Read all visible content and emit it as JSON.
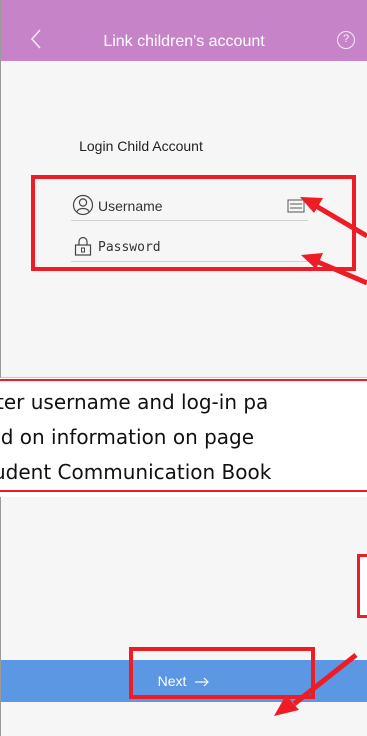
{
  "header": {
    "title": "Link children's account",
    "back_icon": "chevron-left-icon",
    "help_icon": "help-circle-icon",
    "help_glyph": "?",
    "color": "#c783c7"
  },
  "form": {
    "heading": "Login Child Account",
    "username_placeholder": "Username",
    "password_placeholder": "Password",
    "username_icon": "user-icon",
    "password_icon": "lock-icon",
    "keyboard_icon": "keyboard-icon"
  },
  "caption": {
    "line1": "ter username and log-in pa",
    "line2": "sed on information on page",
    "line3": "udent Communication Book"
  },
  "footer": {
    "next_label": "Next",
    "next_icon": "arrow-right-icon",
    "color": "#5b97e3"
  },
  "annotation": {
    "highlight_color": "#ee1c25"
  }
}
